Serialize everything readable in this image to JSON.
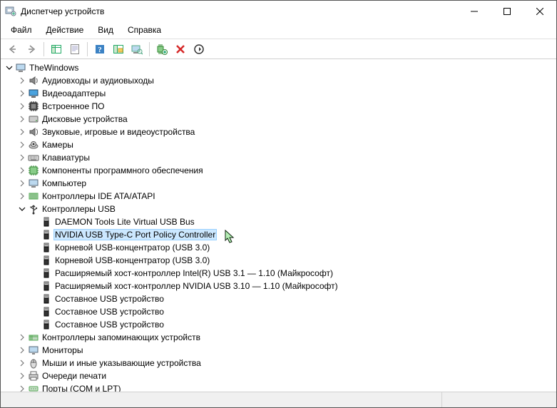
{
  "window": {
    "title": "Диспетчер устройств"
  },
  "menu": {
    "file": "Файл",
    "action": "Действие",
    "view": "Вид",
    "help": "Справка"
  },
  "toolbar": {
    "back": "back",
    "forward": "forward",
    "show_hide_console": "show-hide-console-tree",
    "properties": "properties",
    "help": "help",
    "update_driver": "update-driver",
    "scan_hardware": "scan-hardware",
    "add_legacy": "add-legacy-hardware",
    "uninstall": "uninstall",
    "disable": "disable"
  },
  "tree": {
    "root": "TheWindows",
    "categories": [
      {
        "label": "Аудиовходы и аудиовыходы",
        "icon": "audio"
      },
      {
        "label": "Видеоадаптеры",
        "icon": "display"
      },
      {
        "label": "Встроенное ПО",
        "icon": "firmware"
      },
      {
        "label": "Дисковые устройства",
        "icon": "disk"
      },
      {
        "label": "Звуковые, игровые и видеоустройства",
        "icon": "sound"
      },
      {
        "label": "Камеры",
        "icon": "camera"
      },
      {
        "label": "Клавиатуры",
        "icon": "keyboard"
      },
      {
        "label": "Компоненты программного обеспечения",
        "icon": "software"
      },
      {
        "label": "Компьютер",
        "icon": "computer"
      },
      {
        "label": "Контроллеры IDE ATA/ATAPI",
        "icon": "ide"
      },
      {
        "label": "Контроллеры USB",
        "icon": "usb",
        "expanded": true,
        "children": [
          {
            "label": "DAEMON Tools Lite Virtual USB Bus"
          },
          {
            "label": "NVIDIA USB Type-C Port Policy Controller",
            "selected": true
          },
          {
            "label": "Корневой USB-концентратор (USB 3.0)"
          },
          {
            "label": "Корневой USB-концентратор (USB 3.0)"
          },
          {
            "label": "Расширяемый хост-контроллер Intel(R) USB 3.1 — 1.10 (Майкрософт)"
          },
          {
            "label": "Расширяемый хост-контроллер NVIDIA USB 3.10 — 1.10 (Майкрософт)"
          },
          {
            "label": "Составное USB устройство"
          },
          {
            "label": "Составное USB устройство"
          },
          {
            "label": "Составное USB устройство"
          }
        ]
      },
      {
        "label": "Контроллеры запоминающих устройств",
        "icon": "storage"
      },
      {
        "label": "Мониторы",
        "icon": "monitor"
      },
      {
        "label": "Мыши и иные указывающие устройства",
        "icon": "mouse"
      },
      {
        "label": "Очереди печати",
        "icon": "printqueue"
      },
      {
        "label": "Порты (COM и LPT)",
        "icon": "port",
        "cut": true
      }
    ]
  }
}
